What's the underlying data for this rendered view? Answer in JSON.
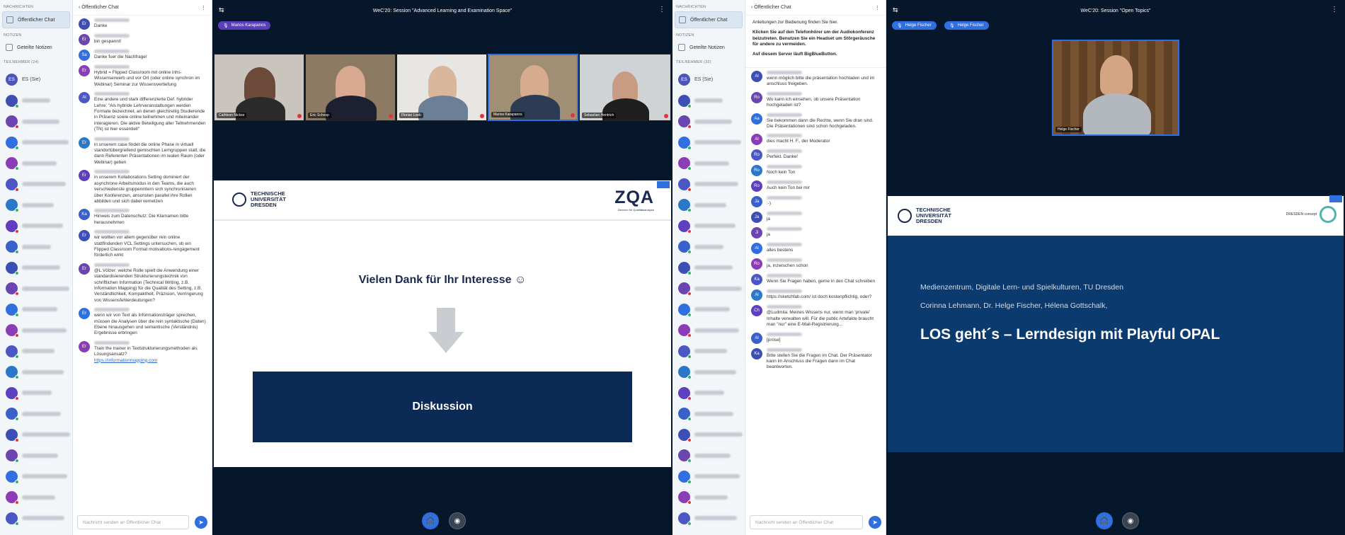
{
  "left_nav": {
    "section_messages": "NACHRICHTEN",
    "public_chat": "Öffentlicher Chat",
    "section_notes": "NOTIZEN",
    "shared_notes": "Geteilte Notizen",
    "section_participants": "TEILNEHMER (24)",
    "self_label": "ES (Sie)"
  },
  "left_chat": {
    "header": "Öffentlicher Chat",
    "messages": [
      {
        "initials": "Er",
        "text": "Danke"
      },
      {
        "initials": "Er",
        "text": "bin gespannt!"
      },
      {
        "initials": "Sa",
        "text": "Danke fuer die Nachfrage!"
      },
      {
        "initials": "Er",
        "text": "Hybrid = Flipped Classroom mit online inhs-Wissenserwerb und vor Ort (oder online synchron im Webinar) Seminar zur Wissensvertiefung"
      },
      {
        "initials": "Al",
        "text": "Eine andere und stark differenzierte Def. hybrider Lehre: \"Als hybride Lehrveranstaltungen werden Formate bezeichnet, an denen gleichzeitig Studierende in Präsenz sowie online teilnehmen und miteinander interagieren. Die aktive Beteiligung aller Teilnehmenden (TN) ist hier essentiell\""
      },
      {
        "initials": "Er",
        "text": "in unserem case findet die online Phase in virtuell standortübergreifend gemischten Lerngruppen statt, die dann Referenten Präsentationen im realen Raum (oder Webinar) geben"
      },
      {
        "initials": "Er",
        "text": "in unserem Kollaborations Setting dominiert der asynchrone Arbeitsmodus in den Teams, die auch verschiedenste gruppenintern sich synchronisieren über Konferenzen, ansonsten parallel ihre Rollen abbilden und sich dabei vernetzen"
      },
      {
        "initials": "Ka",
        "text": "Hinweis zum Datenschutz: Die Klarnamen bitte herausnehmen"
      },
      {
        "initials": "Er",
        "text": "wir wollten vor allem gegenüber rein online stattfindenden VCL Settings untersuchen, ob ein Flipped Classroom Format motivations-/engagement förderlich wirkt"
      },
      {
        "initials": "Er",
        "text": "@L.Völzer: welche Rolle spielt die Anwendung einer standardisierenden Strukturierungstechnik von schriftlichen Information (Technical Writing, z.B. Information Mapping) für die Qualität des Setting, z.B. Verständlichkeit, Kompaktheit, Präzision, Verringerung von Wissensfehlerdeutungen?"
      },
      {
        "initials": "Er",
        "text": "wenn wir von Text als Informationsträger sprechen, müssen die Analysen über die rein syntaktische (Daten) Ebene hinausgehen und semantische (Verständnis) Ergebnisse erbringen"
      },
      {
        "initials": "Er",
        "text": "Train the trainer in Textstrukturierungsmethoden als Lösungsansatz?",
        "link": "https://informationmapping.com"
      }
    ],
    "input_placeholder": "Nachricht senden an Öffentlicher Chat"
  },
  "stage1": {
    "title": "WeC'20: Session \"Advanced Learning and Examination Space\"",
    "presenter_pill": "Marios Karapanos",
    "tiles": [
      {
        "name": "Cathleen Nickse"
      },
      {
        "name": "Eric Schoop"
      },
      {
        "name": "Florian Loeb"
      },
      {
        "name": "Marios Karapanos"
      },
      {
        "name": "Sebastian Hentrich"
      }
    ],
    "slide": {
      "university": "TECHNISCHE\nUNIVERSITÄT\nDRESDEN",
      "brand": "ZQA",
      "brand_sub": "Zentrum für Qualitätsanalyse",
      "thanks": "Vielen Dank für Ihr Interesse ☺",
      "discussion": "Diskussion"
    }
  },
  "right_nav": {
    "section_messages": "NACHRICHTEN",
    "public_chat": "Öffentlicher Chat",
    "section_notes": "NOTIZEN",
    "shared_notes": "Geteilte Notizen",
    "section_participants": "TEILNEHMER (32)",
    "self_label": "ES (Sie)"
  },
  "right_chat": {
    "header": "Öffentlicher Chat",
    "welcome": [
      "Anleitungen zur Bedienung finden Sie hier.",
      "Klicken Sie auf den Telefonhörer um der Audiokonferenz beizutreten. Benutzen Sie ein Headset um Störgeräusche für andere zu vermeiden.",
      "Auf diesem Server läuft BigBlueButton."
    ],
    "messages": [
      {
        "initials": "Al",
        "text": "wenn möglich bitte die präsentation hochladen und im anschluss freigeben."
      },
      {
        "initials": "Ro",
        "text": "Wo kann ich einsehen, ob unsere Präsentation hochgeladen ist?"
      },
      {
        "initials": "Aa",
        "text": "Sie bekommen dann die Rechte, wenn Sie dran sind. Die Präsentationen sind schon hochgeladen."
      },
      {
        "initials": "Al",
        "text": "dies macht H. F., der Moderator"
      },
      {
        "initials": "Ro",
        "text": "Perfekt. Danke!"
      },
      {
        "initials": "Ro",
        "text": "Noch kein Ton"
      },
      {
        "initials": "Ro",
        "text": "Auch kein Ton bei mir"
      },
      {
        "initials": "Ja",
        "text": ":-)"
      },
      {
        "initials": "Ja",
        "text": "ja"
      },
      {
        "initials": "Ji",
        "text": "ja"
      },
      {
        "initials": "Al",
        "text": "alles bestens"
      },
      {
        "initials": "Ro",
        "text": "ja, inzwischen schon"
      },
      {
        "initials": "Ka",
        "text": "Wenn Sie Fragen haben, gerne in den Chat schreiben"
      },
      {
        "initials": "Al",
        "text": "https://sketchfab.com/ ist doch kostenpflichtig, oder?"
      },
      {
        "initials": "Ch",
        "text": "@Ludmila: Meines Wissens nur, wenn man 'private' Inhalte verwalten will. Für die public Artefakte braucht man \"nur\" eine E-Mail-Registrierung..."
      },
      {
        "initials": "Al",
        "text": "[prose]"
      },
      {
        "initials": "Ka",
        "text": "Bitte stellen Sie die Fragen im Chat. Der Präsentator kann im Anschluss die Fragen dann im Chat beantworten."
      }
    ],
    "input_placeholder": "Nachricht senden an Öffentlicher Chat"
  },
  "stage2": {
    "title": "WeC'20: Session \"Open Topics\"",
    "pills": [
      "Helge Fischer",
      "Helge Fischer"
    ],
    "camera_name": "Helge Fischer",
    "slide": {
      "university": "TECHNISCHE\nUNIVERSITÄT\nDRESDEN",
      "brand": "DRESDEN concept",
      "line1": "Medienzentrum, Digitale Lern- und Spielkulturen, TU Dresden",
      "line2": "Corinna Lehmann, Dr. Helge Fischer, Hélena Gottschalk,",
      "headline": "LOS geht´s – Lerndesign mit Playful OPAL"
    }
  },
  "colors": {
    "stage_bg": "#06172b",
    "slide_blue": "#0b3a6e",
    "accent": "#2f6fe0",
    "pill": "#5a3fbd"
  }
}
